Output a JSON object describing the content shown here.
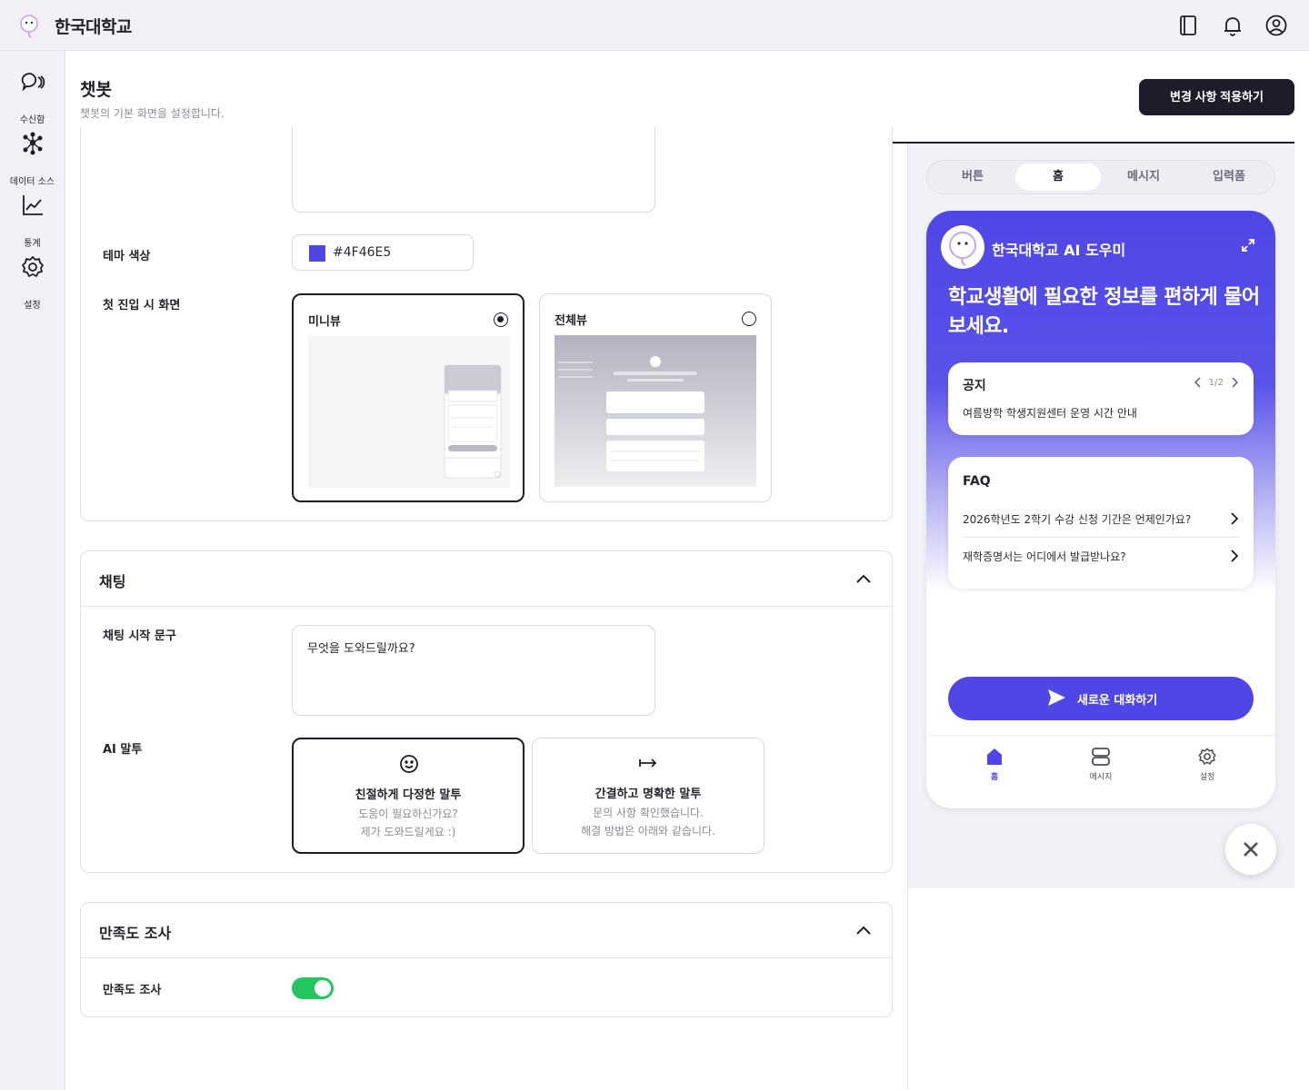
{
  "app": {
    "brand": "한국대학교"
  },
  "sidebar": {
    "items": [
      {
        "label": "수신함",
        "icon": "chat-icon"
      },
      {
        "label": "데이터 소스",
        "icon": "network-icon"
      },
      {
        "label": "통계",
        "icon": "chart-icon"
      },
      {
        "label": "설정",
        "icon": "gear-icon"
      }
    ]
  },
  "header": {
    "title": "챗봇",
    "subtitle": "챗봇의 기본 화면을 설정합니다.",
    "apply_label": "변경 사항 적용하기"
  },
  "appearance": {
    "theme_label": "테마 색상",
    "theme_value": "#4F46E5",
    "first_view_label": "첫 진입 시 화면",
    "views": [
      {
        "label": "미니뷰",
        "selected": true
      },
      {
        "label": "전체뷰",
        "selected": false
      }
    ]
  },
  "chatting": {
    "title": "채팅",
    "start_label": "채팅 시작 문구",
    "start_value": "무엇을 도와드릴까요?",
    "tone_label": "AI 말투",
    "tones": [
      {
        "title": "친절하게 다정한 말투",
        "line1": "도움이 필요하신가요?",
        "line2": "제가 도와드릴게요 :)",
        "selected": true
      },
      {
        "title": "간결하고 명확한 말투",
        "line1": "문의 사항 확인했습니다.",
        "line2": "해결 방법은 아래와 같습니다.",
        "selected": false
      }
    ]
  },
  "survey": {
    "title": "만족도 조사",
    "toggle_label": "만족도 조사",
    "enabled": true
  },
  "preview": {
    "tabs": [
      "버튼",
      "홈",
      "메시지",
      "입력폼"
    ],
    "active_tab": "홈",
    "bot_name": "한국대학교 AI 도우미",
    "hero": "학교생활에 필요한 정보를 편하게 물어보세요.",
    "notice": {
      "title": "공지",
      "pager": "1/2",
      "text": "여름방학 학생지원센터 운영 시간 안내"
    },
    "faq": {
      "title": "FAQ",
      "items": [
        "2026학년도 2학기 수강 신청 기간은 언제인가요?",
        "재학증명서는 어디에서 발급받나요?"
      ]
    },
    "new_chat_label": "새로운 대화하기",
    "nav": [
      "홈",
      "메시지",
      "설정"
    ]
  },
  "colors": {
    "accent": "#4F46E5",
    "dark": "#1C1D28",
    "toggle_on": "#22C55E"
  }
}
